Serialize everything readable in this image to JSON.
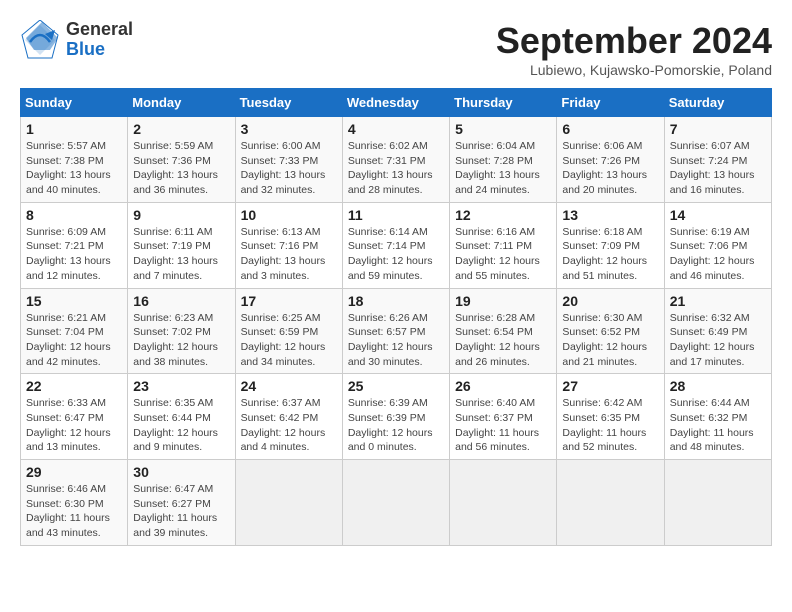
{
  "header": {
    "logo_general": "General",
    "logo_blue": "Blue",
    "title": "September 2024",
    "location": "Lubiewo, Kujawsko-Pomorskie, Poland"
  },
  "weekdays": [
    "Sunday",
    "Monday",
    "Tuesday",
    "Wednesday",
    "Thursday",
    "Friday",
    "Saturday"
  ],
  "weeks": [
    [
      {
        "day": "1",
        "info": "Sunrise: 5:57 AM\nSunset: 7:38 PM\nDaylight: 13 hours\nand 40 minutes."
      },
      {
        "day": "2",
        "info": "Sunrise: 5:59 AM\nSunset: 7:36 PM\nDaylight: 13 hours\nand 36 minutes."
      },
      {
        "day": "3",
        "info": "Sunrise: 6:00 AM\nSunset: 7:33 PM\nDaylight: 13 hours\nand 32 minutes."
      },
      {
        "day": "4",
        "info": "Sunrise: 6:02 AM\nSunset: 7:31 PM\nDaylight: 13 hours\nand 28 minutes."
      },
      {
        "day": "5",
        "info": "Sunrise: 6:04 AM\nSunset: 7:28 PM\nDaylight: 13 hours\nand 24 minutes."
      },
      {
        "day": "6",
        "info": "Sunrise: 6:06 AM\nSunset: 7:26 PM\nDaylight: 13 hours\nand 20 minutes."
      },
      {
        "day": "7",
        "info": "Sunrise: 6:07 AM\nSunset: 7:24 PM\nDaylight: 13 hours\nand 16 minutes."
      }
    ],
    [
      {
        "day": "8",
        "info": "Sunrise: 6:09 AM\nSunset: 7:21 PM\nDaylight: 13 hours\nand 12 minutes."
      },
      {
        "day": "9",
        "info": "Sunrise: 6:11 AM\nSunset: 7:19 PM\nDaylight: 13 hours\nand 7 minutes."
      },
      {
        "day": "10",
        "info": "Sunrise: 6:13 AM\nSunset: 7:16 PM\nDaylight: 13 hours\nand 3 minutes."
      },
      {
        "day": "11",
        "info": "Sunrise: 6:14 AM\nSunset: 7:14 PM\nDaylight: 12 hours\nand 59 minutes."
      },
      {
        "day": "12",
        "info": "Sunrise: 6:16 AM\nSunset: 7:11 PM\nDaylight: 12 hours\nand 55 minutes."
      },
      {
        "day": "13",
        "info": "Sunrise: 6:18 AM\nSunset: 7:09 PM\nDaylight: 12 hours\nand 51 minutes."
      },
      {
        "day": "14",
        "info": "Sunrise: 6:19 AM\nSunset: 7:06 PM\nDaylight: 12 hours\nand 46 minutes."
      }
    ],
    [
      {
        "day": "15",
        "info": "Sunrise: 6:21 AM\nSunset: 7:04 PM\nDaylight: 12 hours\nand 42 minutes."
      },
      {
        "day": "16",
        "info": "Sunrise: 6:23 AM\nSunset: 7:02 PM\nDaylight: 12 hours\nand 38 minutes."
      },
      {
        "day": "17",
        "info": "Sunrise: 6:25 AM\nSunset: 6:59 PM\nDaylight: 12 hours\nand 34 minutes."
      },
      {
        "day": "18",
        "info": "Sunrise: 6:26 AM\nSunset: 6:57 PM\nDaylight: 12 hours\nand 30 minutes."
      },
      {
        "day": "19",
        "info": "Sunrise: 6:28 AM\nSunset: 6:54 PM\nDaylight: 12 hours\nand 26 minutes."
      },
      {
        "day": "20",
        "info": "Sunrise: 6:30 AM\nSunset: 6:52 PM\nDaylight: 12 hours\nand 21 minutes."
      },
      {
        "day": "21",
        "info": "Sunrise: 6:32 AM\nSunset: 6:49 PM\nDaylight: 12 hours\nand 17 minutes."
      }
    ],
    [
      {
        "day": "22",
        "info": "Sunrise: 6:33 AM\nSunset: 6:47 PM\nDaylight: 12 hours\nand 13 minutes."
      },
      {
        "day": "23",
        "info": "Sunrise: 6:35 AM\nSunset: 6:44 PM\nDaylight: 12 hours\nand 9 minutes."
      },
      {
        "day": "24",
        "info": "Sunrise: 6:37 AM\nSunset: 6:42 PM\nDaylight: 12 hours\nand 4 minutes."
      },
      {
        "day": "25",
        "info": "Sunrise: 6:39 AM\nSunset: 6:39 PM\nDaylight: 12 hours\nand 0 minutes."
      },
      {
        "day": "26",
        "info": "Sunrise: 6:40 AM\nSunset: 6:37 PM\nDaylight: 11 hours\nand 56 minutes."
      },
      {
        "day": "27",
        "info": "Sunrise: 6:42 AM\nSunset: 6:35 PM\nDaylight: 11 hours\nand 52 minutes."
      },
      {
        "day": "28",
        "info": "Sunrise: 6:44 AM\nSunset: 6:32 PM\nDaylight: 11 hours\nand 48 minutes."
      }
    ],
    [
      {
        "day": "29",
        "info": "Sunrise: 6:46 AM\nSunset: 6:30 PM\nDaylight: 11 hours\nand 43 minutes."
      },
      {
        "day": "30",
        "info": "Sunrise: 6:47 AM\nSunset: 6:27 PM\nDaylight: 11 hours\nand 39 minutes."
      },
      {
        "day": "",
        "info": ""
      },
      {
        "day": "",
        "info": ""
      },
      {
        "day": "",
        "info": ""
      },
      {
        "day": "",
        "info": ""
      },
      {
        "day": "",
        "info": ""
      }
    ]
  ]
}
